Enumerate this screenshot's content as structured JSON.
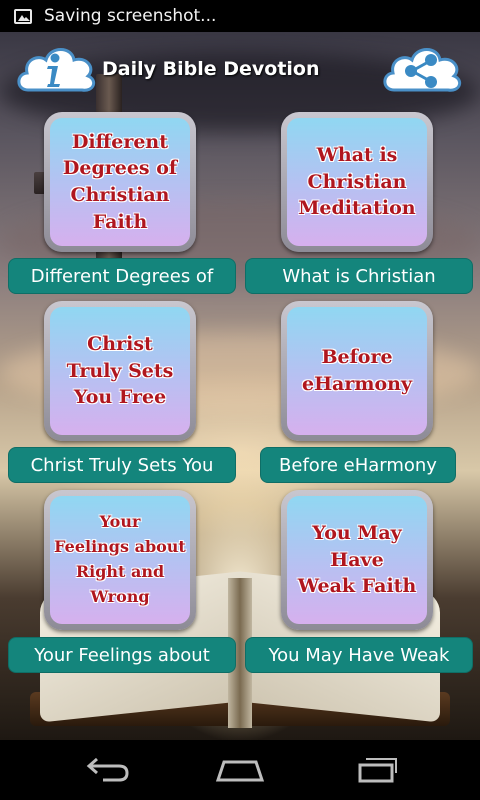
{
  "status_bar": {
    "icon": "image-icon",
    "text": "Saving screenshot..."
  },
  "header": {
    "title": "Daily Bible Devotion",
    "info_icon": "info-icon",
    "share_icon": "share-icon"
  },
  "devotions": [
    {
      "tile_text": "Different\nDegrees of\nChristian\nFaith",
      "label": "Different Degrees of"
    },
    {
      "tile_text": "What is\nChristian\nMeditation",
      "label": "What is Christian"
    },
    {
      "tile_text": "Christ\nTruly Sets\nYou Free",
      "label": "Christ Truly Sets You"
    },
    {
      "tile_text": "Before\neHarmony",
      "label": "Before eHarmony"
    },
    {
      "tile_text": "Your\nFeelings about\nRight and\nWrong",
      "label": "Your Feelings about"
    },
    {
      "tile_text": "You May\nHave\nWeak Faith",
      "label": "You May Have Weak"
    }
  ],
  "nav_bar": {
    "back_icon": "back-icon",
    "home_icon": "home-icon",
    "recents_icon": "recents-icon"
  },
  "colors": {
    "label_bar": "#14857c",
    "tile_text": "#b0161e",
    "tile_top": "#90d7f2",
    "tile_bottom": "#d6b0ee"
  }
}
